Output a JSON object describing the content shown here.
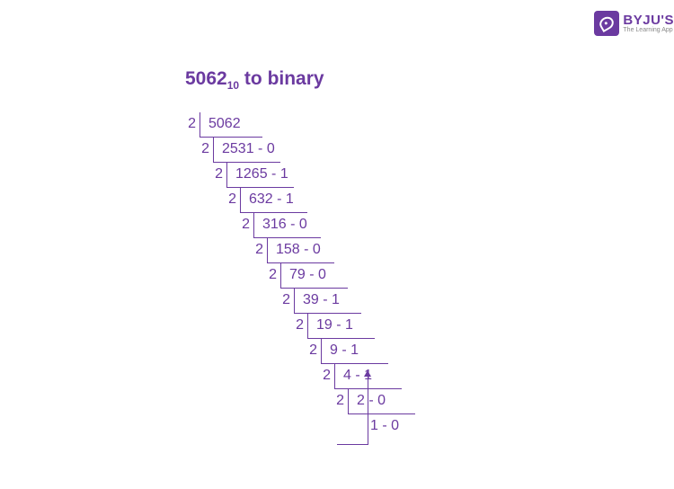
{
  "logo": {
    "main": "BYJU'S",
    "sub": "The Learning App"
  },
  "title": {
    "number": "5062",
    "base": "10",
    "suffix": " to binary"
  },
  "steps": [
    {
      "divisor": "2",
      "value": "5062",
      "remainder": ""
    },
    {
      "divisor": "2",
      "value": "2531",
      "remainder": "0"
    },
    {
      "divisor": "2",
      "value": "1265",
      "remainder": "1"
    },
    {
      "divisor": "2",
      "value": "632",
      "remainder": "1"
    },
    {
      "divisor": "2",
      "value": "316",
      "remainder": "0"
    },
    {
      "divisor": "2",
      "value": "158",
      "remainder": "0"
    },
    {
      "divisor": "2",
      "value": "79",
      "remainder": "0"
    },
    {
      "divisor": "2",
      "value": "39",
      "remainder": "1"
    },
    {
      "divisor": "2",
      "value": "19",
      "remainder": "1"
    },
    {
      "divisor": "2",
      "value": "9",
      "remainder": "1"
    },
    {
      "divisor": "2",
      "value": "4",
      "remainder": "1"
    },
    {
      "divisor": "2",
      "value": "2",
      "remainder": "0"
    },
    {
      "divisor": "",
      "value": "1",
      "remainder": "0"
    }
  ]
}
